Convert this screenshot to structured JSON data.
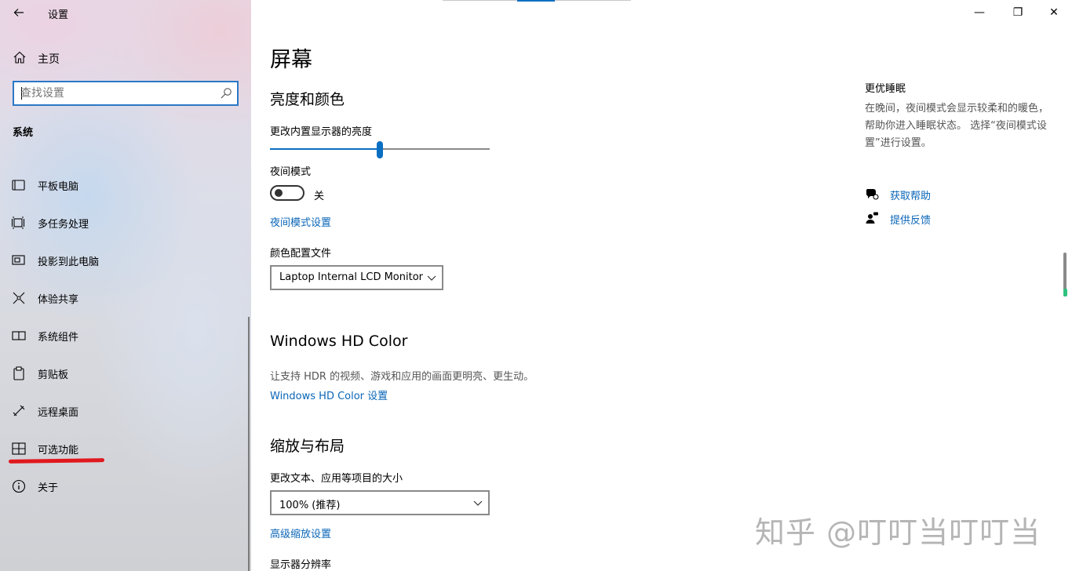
{
  "app": {
    "title": "设置",
    "back_icon": "arrow-left-icon"
  },
  "sidebar": {
    "home_label": "主页",
    "search": {
      "placeholder": "查找设置",
      "value": ""
    },
    "section_label": "系统",
    "items": [
      {
        "label": "平板电脑",
        "icon": "tablet-icon"
      },
      {
        "label": "多任务处理",
        "icon": "multitask-icon"
      },
      {
        "label": "投影到此电脑",
        "icon": "project-icon"
      },
      {
        "label": "体验共享",
        "icon": "share-icon"
      },
      {
        "label": "系统组件",
        "icon": "components-icon"
      },
      {
        "label": "剪贴板",
        "icon": "clipboard-icon"
      },
      {
        "label": "远程桌面",
        "icon": "remote-desktop-icon"
      },
      {
        "label": "可选功能",
        "icon": "optional-features-icon",
        "highlighted": true
      },
      {
        "label": "关于",
        "icon": "info-icon"
      }
    ]
  },
  "window_controls": {
    "minimize": "—",
    "restore": "❐",
    "close": "✕"
  },
  "main": {
    "page_title": "屏幕",
    "brightness_color": {
      "heading": "亮度和颜色",
      "brightness_label": "更改内置显示器的亮度",
      "brightness_value": 50,
      "night_mode_label": "夜间模式",
      "night_mode_state": "关",
      "night_mode_on": false,
      "night_settings_link": "夜间模式设置",
      "color_profile_label": "颜色配置文件",
      "color_profile_value": "Laptop Internal LCD Monitor"
    },
    "hd_color": {
      "heading": "Windows HD Color",
      "description": "让支持 HDR 的视频、游戏和应用的画面更明亮、更生动。",
      "link": "Windows HD Color 设置"
    },
    "scale_layout": {
      "heading": "缩放与布局",
      "size_label": "更改文本、应用等项目的大小",
      "size_value": "100% (推荐)",
      "advanced_link": "高级缩放设置",
      "resolution_label": "显示器分辨率"
    }
  },
  "right_panel": {
    "title": "更优睡眠",
    "description": "在晚间，夜间模式会显示较柔和的暖色，帮助你进入睡眠状态。 选择“夜间模式设置”进行设置。",
    "help_link": "获取帮助",
    "feedback_link": "提供反馈"
  },
  "watermark": "知乎 @叮叮当叮叮当",
  "colors": {
    "accent": "#0a6fc2",
    "link": "#0a66b8",
    "underline": "#e0181e"
  }
}
